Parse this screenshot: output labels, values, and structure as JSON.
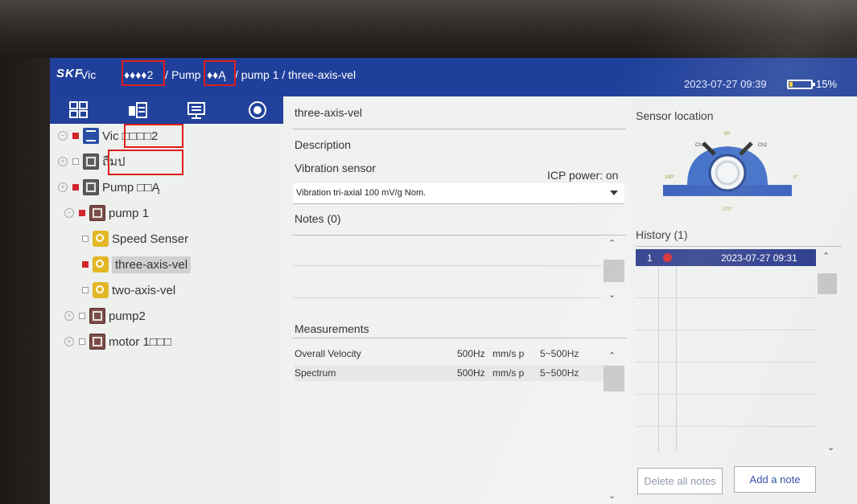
{
  "header": {
    "logo": "SKF",
    "crumb_a": "Vic",
    "crumb_a_garbled": "♦♦♦♦2",
    "crumb_sep1": "/",
    "crumb_b": "Pump",
    "crumb_b_garbled": "♦♦Ą",
    "crumb_tail": "/ pump 1 / three-axis-vel",
    "datetime": "2023-07-27 09:39",
    "battery": "15%",
    "battery_level": 0.15
  },
  "tree": [
    {
      "label": "Vic □□□□2",
      "icon": "database-icon",
      "status": "red"
    },
    {
      "label": "ถืมป",
      "icon": "machine-icon",
      "status": "empty"
    },
    {
      "label": "Pump □□Ą",
      "icon": "machine-icon",
      "status": "red"
    },
    {
      "label": "pump 1",
      "icon": "asset-icon",
      "status": "red"
    },
    {
      "label": "Speed Senser",
      "icon": "sensor-icon",
      "status": "empty"
    },
    {
      "label": "three-axis-vel",
      "icon": "sensor-icon",
      "status": "red"
    },
    {
      "label": "two-axis-vel",
      "icon": "sensor-icon",
      "status": "empty"
    },
    {
      "label": "pump2",
      "icon": "asset-icon",
      "status": "empty"
    },
    {
      "label": "motor 1□□□",
      "icon": "asset-icon",
      "status": "empty"
    }
  ],
  "detail": {
    "title": "three-axis-vel",
    "description_label": "Description",
    "sensor_type_label": "Vibration sensor",
    "icp_power": "ICP power: on",
    "sensor_model": "Vibration tri-axial 100 mV/g Nom.",
    "notes_label": "Notes (0)",
    "measurements_label": "Measurements",
    "measurements": [
      {
        "name": "Overall Velocity",
        "range": "500Hz",
        "unit": "mm/s p",
        "band": "5~500Hz"
      },
      {
        "name": "Spectrum",
        "range": "500Hz",
        "unit": "mm/s p",
        "band": "5~500Hz"
      }
    ]
  },
  "side": {
    "sensor_location_label": "Sensor location",
    "diagram_labels": {
      "top": "90°",
      "ch1": "Ch1",
      "ch2": "Ch2",
      "left": "180°",
      "right": "0°",
      "bottom": "270°"
    },
    "history_label": "History (1)",
    "history": [
      {
        "index": "1",
        "datetime": "2023-07-27 09:31"
      }
    ],
    "delete_notes_label": "Delete all notes",
    "add_note_label": "Add a note"
  },
  "colors": {
    "topbar": "#1f3f9a",
    "alarm_red": "#d2242c",
    "sensor_yellow": "#e2b625",
    "history_row": "#2a3a8a"
  }
}
